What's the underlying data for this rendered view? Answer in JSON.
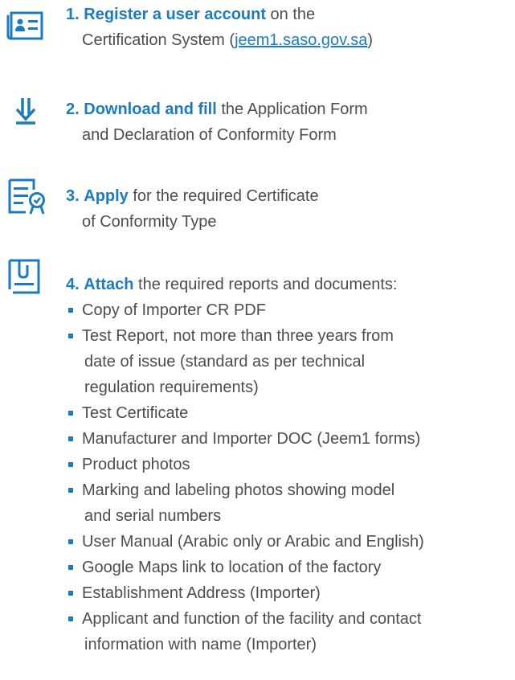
{
  "steps": [
    {
      "icon": "id-card-icon",
      "number": "1.",
      "highlight": "Register a user account",
      "text_after": " on the",
      "line2_before": "Certification System (",
      "link": "jeem1.saso.gov.sa",
      "line2_after": ")"
    },
    {
      "icon": "download-icon",
      "number": "2.",
      "highlight": "Download and fill",
      "text_after": " the Application Form",
      "line2": "and Declaration of Conformity Form"
    },
    {
      "icon": "certificate-document-icon",
      "number": "3.",
      "highlight": "Apply",
      "text_after": " for the required Certificate",
      "line2": "of Conformity Type"
    },
    {
      "icon": "attachment-clip-icon",
      "number": "4.",
      "highlight": "Attach",
      "text_after": " the required reports and documents:",
      "documents": [
        {
          "line1": "Copy of Importer CR PDF"
        },
        {
          "line1": "Test Report, not more than three years from",
          "line2": "date of issue (standard as per technical",
          "line3": "regulation requirements)"
        },
        {
          "line1": "Test Certificate"
        },
        {
          "line1": "Manufacturer and Importer DOC (Jeem1 forms)"
        },
        {
          "line1": "Product photos"
        },
        {
          "line1": "Marking and labeling photos showing model",
          "line2": "and serial numbers"
        },
        {
          "line1": "User Manual (Arabic only or Arabic and English)"
        },
        {
          "line1": "Google Maps link to location of the factory"
        },
        {
          "line1": "Establishment Address (Importer)"
        },
        {
          "line1": "Applicant and function of the facility and contact",
          "line2": "information with name (Importer)"
        }
      ]
    }
  ],
  "colors": {
    "accent": "#1c7bc0",
    "text": "#4a4d52"
  }
}
